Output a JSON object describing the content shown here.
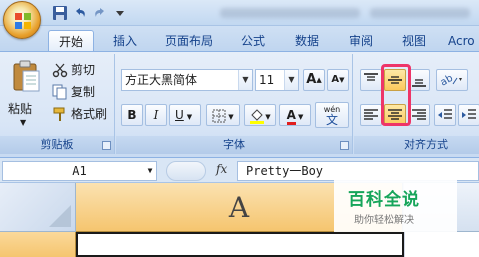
{
  "quick_access": {
    "icons": [
      "save-icon",
      "undo-icon",
      "redo-icon",
      "customize-qat-icon"
    ]
  },
  "tabs": [
    {
      "label": "开始",
      "active": true
    },
    {
      "label": "插入",
      "active": false
    },
    {
      "label": "页面布局",
      "active": false
    },
    {
      "label": "公式",
      "active": false
    },
    {
      "label": "数据",
      "active": false
    },
    {
      "label": "审阅",
      "active": false
    },
    {
      "label": "视图",
      "active": false
    },
    {
      "label": "Acro",
      "active": false
    }
  ],
  "clipboard": {
    "paste_label": "粘贴",
    "cut_label": "剪切",
    "copy_label": "复制",
    "format_painter_label": "格式刷",
    "group_label": "剪贴板"
  },
  "font": {
    "font_name": "方正大黑简体",
    "font_size": "11",
    "grow_label": "A",
    "shrink_label": "A",
    "bold_label": "B",
    "italic_label": "I",
    "underline_label": "U",
    "font_color_label": "A",
    "phonetic_label": "wén",
    "phonetic_char": "文",
    "group_label": "字体"
  },
  "alignment": {
    "group_label": "对齐方式",
    "icons": [
      "align-top-icon",
      "align-middle-icon",
      "align-bottom-icon",
      "orientation-icon",
      "align-left-icon",
      "align-center-icon",
      "align-right-icon",
      "decrease-indent-icon",
      "increase-indent-icon"
    ]
  },
  "formula_bar": {
    "name_box": "A1",
    "fx_label": "fx",
    "formula": "Pretty一Boy"
  },
  "grid": {
    "column_header": "A"
  },
  "watermark": {
    "title": "百科全说",
    "subtitle": "助你轻松解决"
  },
  "colors": {
    "highlight_border": "#ee3568",
    "active_button": "#fbc85c",
    "watermark_green": "#16a55a",
    "font_color_red": "#e11e1e",
    "fill_color_yellow": "#ffff00"
  }
}
